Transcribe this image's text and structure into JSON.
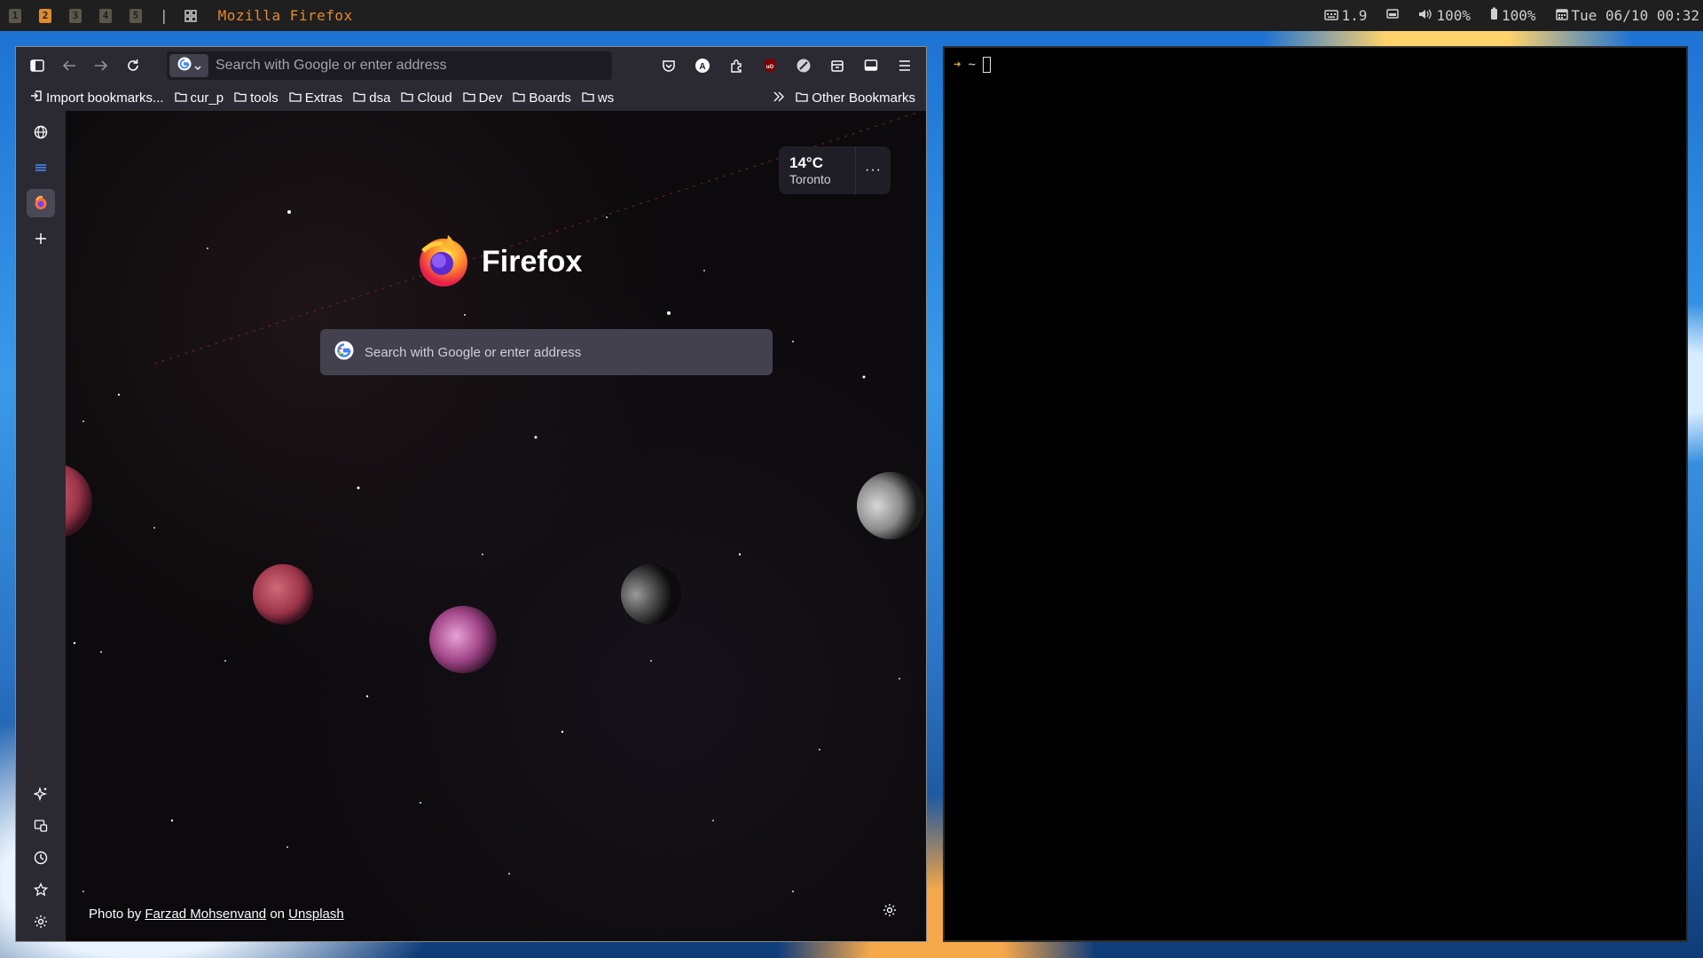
{
  "topbar": {
    "workspaces": [
      "1",
      "2",
      "3",
      "4",
      "5"
    ],
    "active_workspace": "2",
    "separator": "|",
    "window_title": "Mozilla Firefox",
    "status": {
      "load": "1.9",
      "volume": "100%",
      "battery": "100%",
      "datetime": "Tue 06/10 00:32"
    }
  },
  "firefox": {
    "urlbar": {
      "placeholder": "Search with Google or enter address"
    },
    "bookmarks": {
      "import": "Import bookmarks...",
      "folders": [
        "cur_p",
        "tools",
        "Extras",
        "dsa",
        "Cloud",
        "Dev",
        "Boards",
        "ws"
      ],
      "other": "Other Bookmarks"
    },
    "newtab": {
      "weather": {
        "temp": "14°C",
        "city": "Toronto",
        "more": "···"
      },
      "brand": "Firefox",
      "search_placeholder": "Search with Google or enter address",
      "credit": {
        "prefix": "Photo by",
        "author": "Farzad Mohsenvand",
        "middle": "on",
        "site": "Unsplash"
      }
    }
  },
  "terminal": {
    "prompt_arrow": "➜",
    "cwd": "~"
  }
}
